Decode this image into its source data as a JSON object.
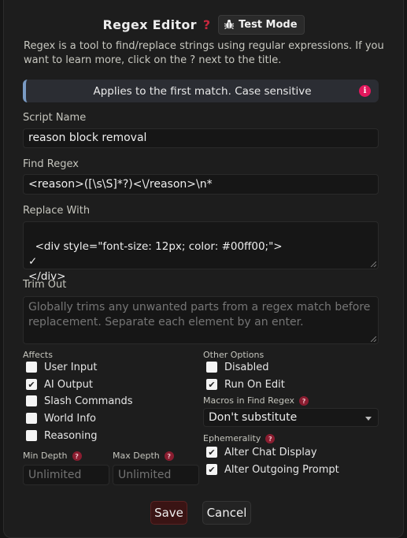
{
  "header": {
    "title": "Regex Editor",
    "help_glyph": "?",
    "test_mode_label": "Test Mode"
  },
  "description": "Regex is a tool to find/replace strings using regular expressions. If you want to learn more, click on the ? next to the title.",
  "info_banner": {
    "text": "Applies to the first match. Case sensitive",
    "icon_glyph": "i"
  },
  "script_name": {
    "label": "Script Name",
    "value": "reason block removal"
  },
  "find_regex": {
    "label": "Find Regex",
    "value": "<reason>([\\s\\S]*?)<\\/reason>\\n*"
  },
  "replace_with": {
    "label": "Replace With",
    "value": "<div style=\"font-size: 12px; color: #00ff00;\">\n✓\n</div>"
  },
  "trim_out": {
    "label": "Trim Out",
    "placeholder": "Globally trims any unwanted parts from a regex match before replacement. Separate each element by an enter."
  },
  "affects": {
    "label": "Affects",
    "items": [
      {
        "label": "User Input",
        "checked": false,
        "mark": ""
      },
      {
        "label": "AI Output",
        "checked": true,
        "mark": "✔"
      },
      {
        "label": "Slash Commands",
        "checked": false,
        "mark": ""
      },
      {
        "label": "World Info",
        "checked": false,
        "mark": ""
      },
      {
        "label": "Reasoning",
        "checked": false,
        "mark": ""
      }
    ]
  },
  "other_options": {
    "label": "Other Options",
    "items": [
      {
        "label": "Disabled",
        "checked": false,
        "mark": ""
      },
      {
        "label": "Run On Edit",
        "checked": true,
        "mark": "✔"
      }
    ]
  },
  "macros": {
    "label": "Macros in Find Regex",
    "selected": "Don't substitute"
  },
  "ephemerality": {
    "label": "Ephemerality",
    "items": [
      {
        "label": "Alter Chat Display",
        "checked": true,
        "mark": "✔"
      },
      {
        "label": "Alter Outgoing Prompt",
        "checked": true,
        "mark": "✔"
      }
    ]
  },
  "min_depth": {
    "label": "Min Depth",
    "placeholder": "Unlimited"
  },
  "max_depth": {
    "label": "Max Depth",
    "placeholder": "Unlimited"
  },
  "help_badge": "?",
  "buttons": {
    "save": "Save",
    "cancel": "Cancel"
  },
  "colors": {
    "accent_red": "#c6283e",
    "info_icon": "#e3175c",
    "save_bg": "#3a1414"
  }
}
